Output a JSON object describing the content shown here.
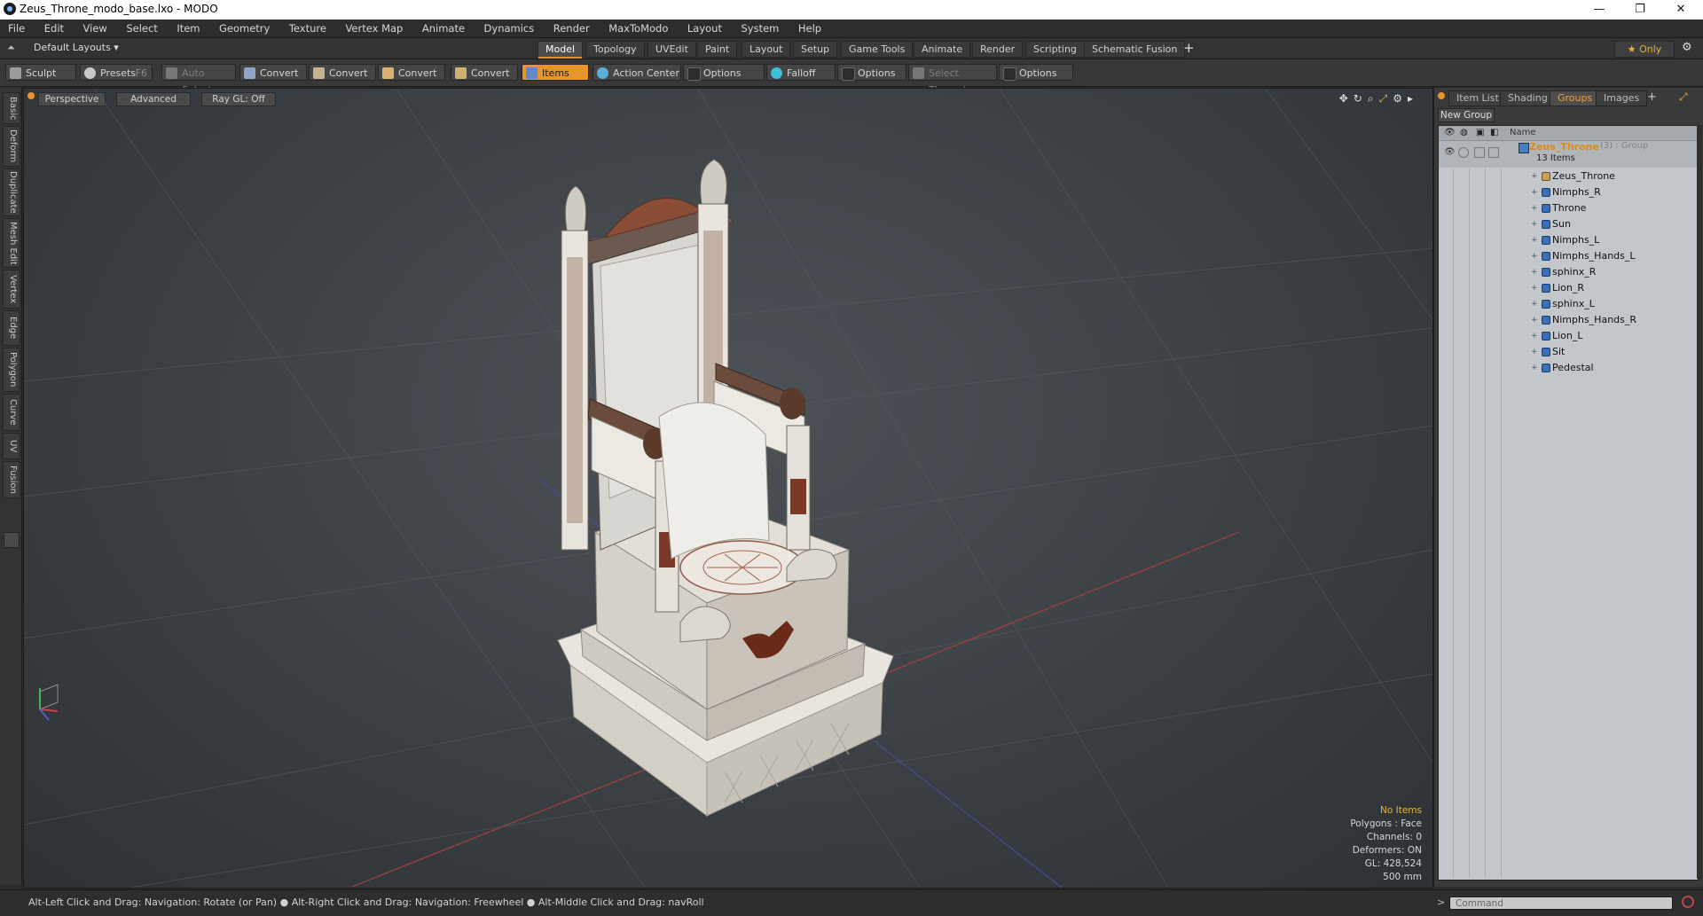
{
  "window": {
    "title": "Zeus_Throne_modo_base.lxo - MODO",
    "minimize": "—",
    "maximize": "❐",
    "close": "✕"
  },
  "menu": [
    "File",
    "Edit",
    "View",
    "Select",
    "Item",
    "Geometry",
    "Texture",
    "Vertex Map",
    "Animate",
    "Dynamics",
    "Render",
    "MaxToModo",
    "Layout",
    "System",
    "Help"
  ],
  "layoutbar": {
    "layout_selector": "Default Layouts ▾",
    "tabs": [
      "Model",
      "Topology",
      "UVEdit",
      "Paint",
      "Layout",
      "Setup",
      "Game Tools",
      "Animate",
      "Render",
      "Scripting",
      "Schematic Fusion"
    ],
    "active_tab": "Model",
    "add": "+",
    "only": "★  Only",
    "gear": "⚙"
  },
  "toolbar": {
    "sculpt": "Sculpt",
    "presets": "Presets",
    "presets_key": "F6",
    "auto_select": "Auto Select",
    "convert1": "Convert",
    "convert2": "Convert",
    "convert3": "Convert",
    "convert4": "Convert",
    "items": "Items",
    "action_center": "Action Center",
    "options1": "Options",
    "falloff": "Falloff",
    "options2": "Options",
    "select_through": "Select Through",
    "options3": "Options"
  },
  "left_tabs": [
    "Basic",
    "Deform",
    "Duplicate",
    "Mesh Edit",
    "Vertex",
    "Edge",
    "Polygon",
    "Curve",
    "UV",
    "Fusion"
  ],
  "viewport": {
    "view": "Perspective",
    "shading": "Advanced",
    "raygl": "Ray GL: Off",
    "hud": {
      "items": "No Items",
      "polygons": "Polygons : Face",
      "channels": "Channels: 0",
      "deformers": "Deformers: ON",
      "gl": "GL: 428,524",
      "scale": "500 mm"
    }
  },
  "right_panel": {
    "tabs": [
      "Item List",
      "Shading",
      "Groups",
      "Images"
    ],
    "active_tab": "Groups",
    "add": "+",
    "new_group": "New Group",
    "name_header": "Name",
    "group_name": "Zeus_Throne",
    "group_suffix": "(3) : Group",
    "group_count": "13 Items",
    "items": [
      "Zeus_Throne",
      "Nimphs_R",
      "Throne",
      "Sun",
      "Nimphs_L",
      "Nimphs_Hands_L",
      "sphinx_R",
      "Lion_R",
      "sphinx_L",
      "Nimphs_Hands_R",
      "Lion_L",
      "Sit",
      "Pedestal"
    ]
  },
  "status": {
    "message": "Alt-Left Click and Drag: Navigation: Rotate (or Pan) ● Alt-Right Click and Drag: Navigation: Freewheel ● Alt-Middle Click and Drag: navRoll",
    "command_placeholder": "Command",
    "prompt": ">"
  },
  "colors": {
    "accent": "#e7952a",
    "viewport_bg": "#3e4348",
    "tree_bg": "#c3c7cc"
  }
}
